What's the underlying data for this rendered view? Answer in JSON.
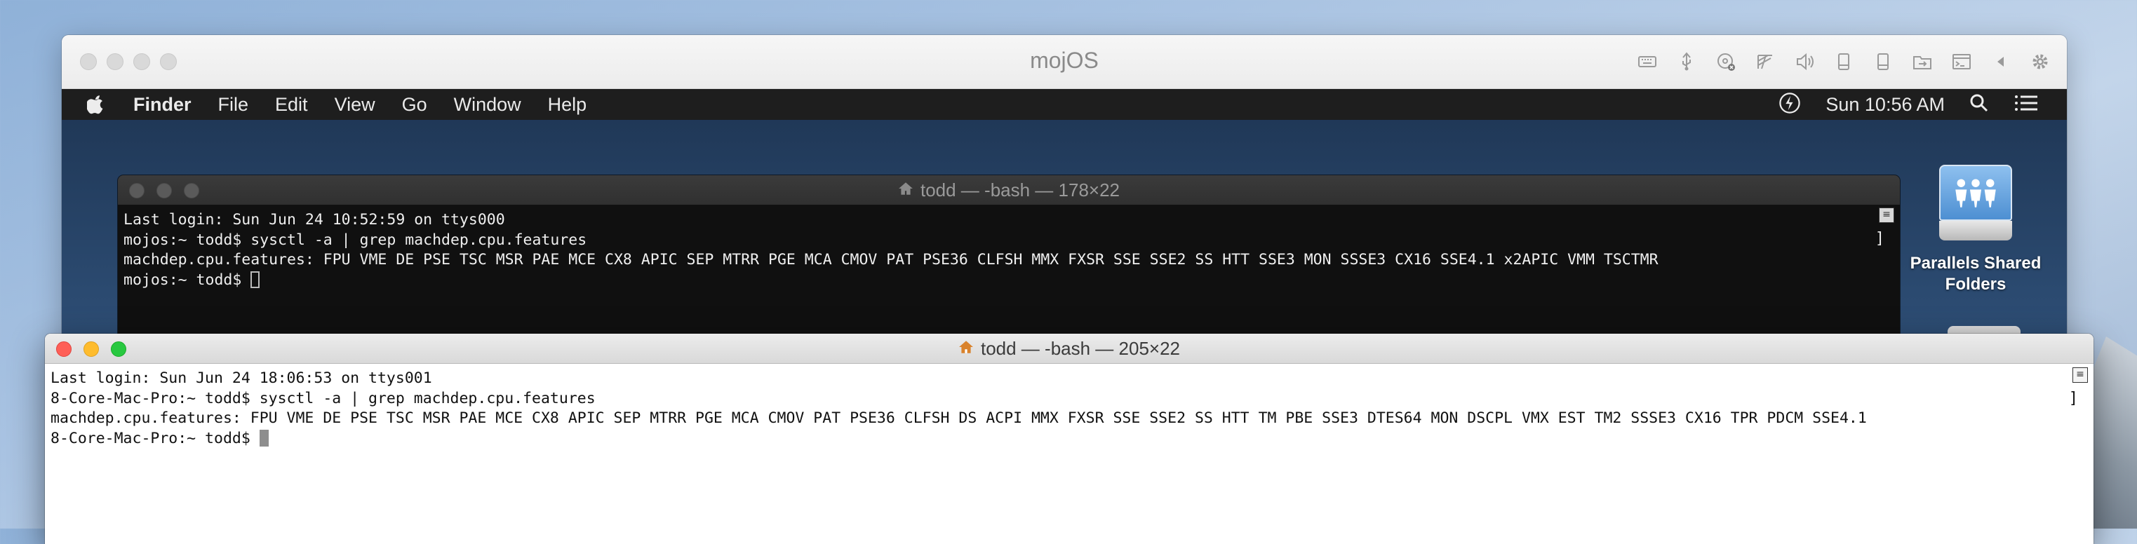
{
  "vm": {
    "title": "mojOS",
    "toolbar_icons": [
      "keyboard-icon",
      "usb-icon",
      "cd-disc-icon",
      "network-icon",
      "volume-icon",
      "device-icon",
      "device-icon",
      "shared-folder-icon",
      "terminal-window-icon",
      "back-arrow-icon",
      "settings-gear-icon"
    ]
  },
  "menubar": {
    "app_name": "Finder",
    "items": [
      "File",
      "Edit",
      "View",
      "Go",
      "Window",
      "Help"
    ],
    "clock": "Sun 10:56 AM"
  },
  "desktop": {
    "shared_folders_label": "Parallels Shared Folders"
  },
  "guest_terminal": {
    "title": "todd — -bash — 178×22",
    "lines": [
      "Last login: Sun Jun 24 10:52:59 on ttys000",
      "mojos:~ todd$ sysctl -a | grep machdep.cpu.features",
      "machdep.cpu.features: FPU VME DE PSE TSC MSR PAE MCE CX8 APIC SEP MTRR PGE MCA CMOV PAT PSE36 CLFSH MMX FXSR SSE SSE2 SS HTT SSE3 MON SSSE3 CX16 SSE4.1 x2APIC VMM TSCTMR"
    ],
    "prompt": "mojos:~ todd$ "
  },
  "host_terminal": {
    "title": "todd — -bash — 205×22",
    "lines": [
      "Last login: Sun Jun 24 18:06:53 on ttys001",
      "8-Core-Mac-Pro:~ todd$ sysctl -a | grep machdep.cpu.features",
      "machdep.cpu.features: FPU VME DE PSE TSC MSR PAE MCE CX8 APIC SEP MTRR PGE MCA CMOV PAT PSE36 CLFSH DS ACPI MMX FXSR SSE SSE2 SS HTT TM PBE SSE3 DTES64 MON DSCPL VMX EST TM2 SSSE3 CX16 TPR PDCM SSE4.1"
    ],
    "prompt": "8-Core-Mac-Pro:~ todd$ "
  },
  "colors": {
    "close": "#fe5f57",
    "minimize": "#febc2e",
    "zoom": "#28c840"
  }
}
